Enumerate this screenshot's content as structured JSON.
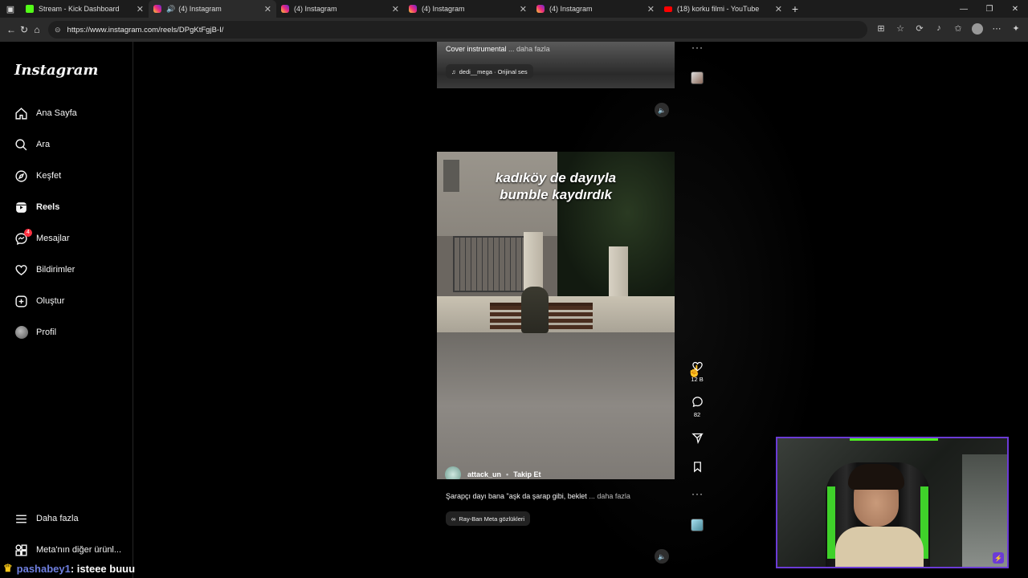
{
  "browser": {
    "tabs": [
      {
        "title": "Stream - Kick Dashboard",
        "favicon": "kick-icon",
        "active": false
      },
      {
        "title": "(4) Instagram",
        "favicon": "instagram-icon",
        "active": true,
        "audio": true
      },
      {
        "title": "(4) Instagram",
        "favicon": "instagram-icon",
        "active": false
      },
      {
        "title": "(4) Instagram",
        "favicon": "instagram-icon",
        "active": false
      },
      {
        "title": "(4) Instagram",
        "favicon": "instagram-icon",
        "active": false
      },
      {
        "title": "(18) korku filmi - YouTube",
        "favicon": "youtube-icon",
        "active": false
      }
    ],
    "url": "https://www.instagram.com/reels/DPgKtFgjB-I/"
  },
  "sidebar": {
    "logo": "Instagram",
    "items": [
      {
        "label": "Ana Sayfa",
        "icon": "home-icon"
      },
      {
        "label": "Ara",
        "icon": "search-icon"
      },
      {
        "label": "Keşfet",
        "icon": "compass-icon"
      },
      {
        "label": "Reels",
        "icon": "reels-icon"
      },
      {
        "label": "Mesajlar",
        "icon": "messenger-icon",
        "badge": "4"
      },
      {
        "label": "Bildirimler",
        "icon": "heart-icon"
      },
      {
        "label": "Oluştur",
        "icon": "plus-square-icon"
      },
      {
        "label": "Profil",
        "icon": "avatar"
      }
    ],
    "more": "Daha fazla",
    "meta": "Meta'nın diğer ürünl..."
  },
  "top_reel": {
    "caption": "Cover instrumental",
    "more": "... daha fazla",
    "audio": "dedi__mega · Orijinal ses"
  },
  "reel": {
    "overlay_line1": "kadıköy de dayıyla",
    "overlay_line2": "bumble kaydırdık",
    "author": "attack_un",
    "follow": "Takip Et",
    "caption": "Şarapçı dayı bana \"aşk da şarap gibi, beklet",
    "more": "... daha fazla",
    "chip": "Ray-Ban Meta gözlükleri",
    "likes": "12 B",
    "comments": "82"
  },
  "chat": {
    "user": "pashabey1",
    "message": ": isteee buuu"
  },
  "colors": {
    "accent_purple": "#6b3bd6",
    "kick_green": "#53fc18",
    "badge_red": "#ff3040"
  }
}
